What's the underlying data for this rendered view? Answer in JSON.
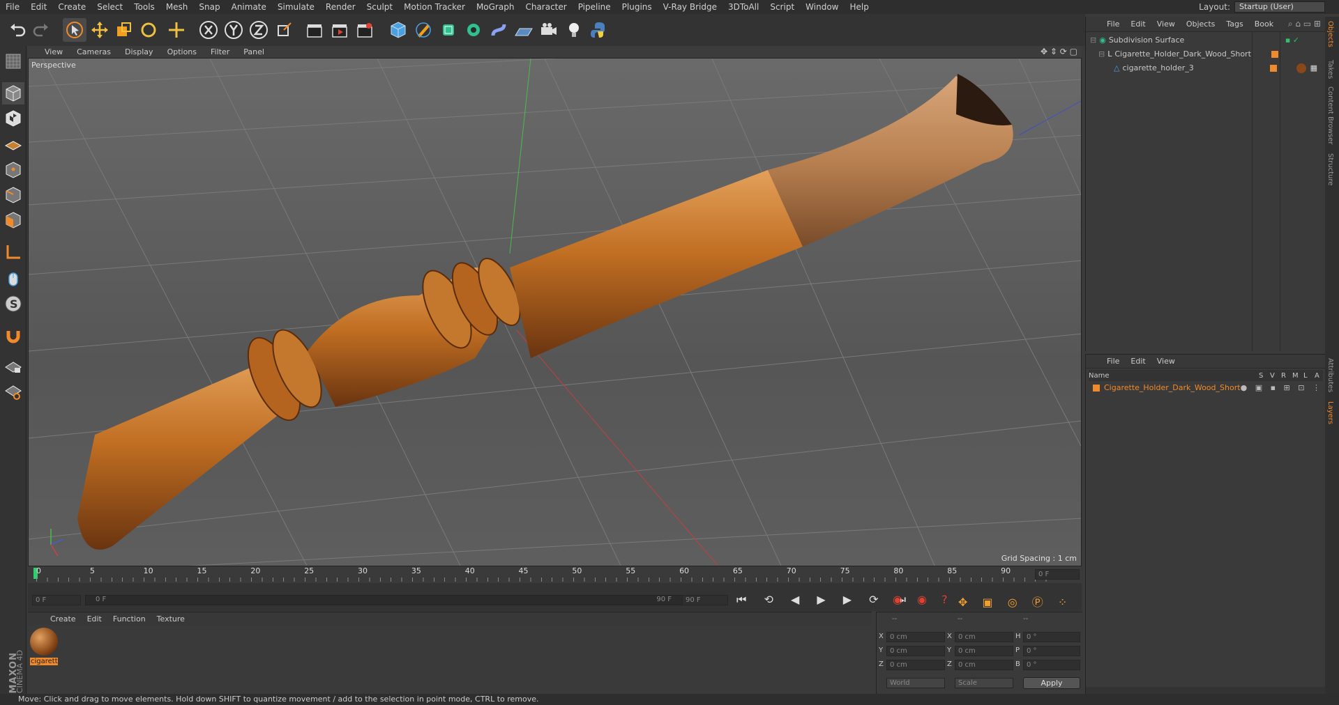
{
  "menu": [
    "File",
    "Edit",
    "Create",
    "Select",
    "Tools",
    "Mesh",
    "Snap",
    "Animate",
    "Simulate",
    "Render",
    "Sculpt",
    "Motion Tracker",
    "MoGraph",
    "Character",
    "Pipeline",
    "Plugins",
    "V-Ray Bridge",
    "3DToAll",
    "Script",
    "Window",
    "Help"
  ],
  "layout": {
    "label": "Layout:",
    "value": "Startup (User)"
  },
  "viewport": {
    "menu": [
      "View",
      "Cameras",
      "Display",
      "Options",
      "Filter",
      "Panel"
    ],
    "label": "Perspective",
    "grid_spacing": "Grid Spacing : 1 cm"
  },
  "timeline": {
    "ticks": [
      "0",
      "5",
      "10",
      "15",
      "20",
      "25",
      "30",
      "35",
      "40",
      "45",
      "50",
      "55",
      "60",
      "65",
      "70",
      "75",
      "80",
      "85",
      "90"
    ],
    "current_frame": "0 F",
    "start": "0 F",
    "range_start": "0 F",
    "range_end": "90 F",
    "end": "90 F"
  },
  "material": {
    "menu": [
      "Create",
      "Edit",
      "Function",
      "Texture"
    ],
    "items": [
      {
        "name": "cigarett"
      }
    ]
  },
  "coords": {
    "headers": [
      "--",
      "--",
      "--"
    ],
    "rows": [
      {
        "a": "X",
        "av": "0 cm",
        "b": "X",
        "bv": "0 cm",
        "c": "H",
        "cv": "0 °"
      },
      {
        "a": "Y",
        "av": "0 cm",
        "b": "Y",
        "bv": "0 cm",
        "c": "P",
        "cv": "0 °"
      },
      {
        "a": "Z",
        "av": "0 cm",
        "b": "Z",
        "bv": "0 cm",
        "c": "B",
        "cv": "0 °"
      }
    ],
    "mode": "World",
    "scale": "Scale",
    "apply": "Apply"
  },
  "objects": {
    "menu": [
      "File",
      "Edit",
      "View",
      "Objects",
      "Tags",
      "Book"
    ],
    "items": [
      {
        "name": "Subdivision Surface"
      },
      {
        "name": "Cigarette_Holder_Dark_Wood_Short"
      },
      {
        "name": "cigarette_holder_3"
      }
    ]
  },
  "layers": {
    "menu": [
      "File",
      "Edit",
      "View"
    ],
    "col_name": "Name",
    "cols": [
      "S",
      "V",
      "R",
      "M",
      "L",
      "A"
    ],
    "items": [
      {
        "name": "Cigarette_Holder_Dark_Wood_Short"
      }
    ]
  },
  "right_tabs": [
    "Objects",
    "Takes",
    "Content Browser",
    "Structure",
    "Attributes",
    "Layers"
  ],
  "brand": {
    "line1": "MAXON",
    "line2": "CINEMA 4D"
  },
  "status": "Move: Click and drag to move elements. Hold down SHIFT to quantize movement / add to the selection in point mode, CTRL to remove.",
  "colors": {
    "accent": "#f08a2a",
    "wood": "#b9661f"
  }
}
